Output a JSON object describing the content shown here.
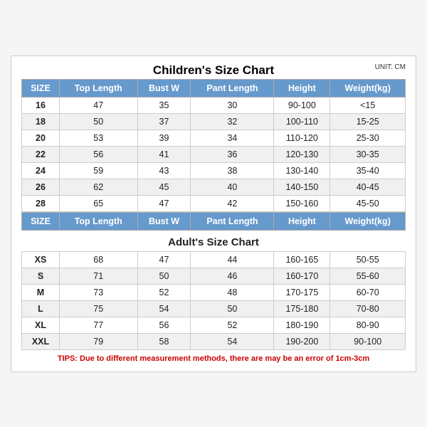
{
  "mainTitle": "Children's Size Chart",
  "unitLabel": "UNIT: CM",
  "children": {
    "headers": [
      "SIZE",
      "Top Length",
      "Bust W",
      "Pant Length",
      "Height",
      "Weight(kg)"
    ],
    "rows": [
      [
        "16",
        "47",
        "35",
        "30",
        "90-100",
        "<15"
      ],
      [
        "18",
        "50",
        "37",
        "32",
        "100-110",
        "15-25"
      ],
      [
        "20",
        "53",
        "39",
        "34",
        "110-120",
        "25-30"
      ],
      [
        "22",
        "56",
        "41",
        "36",
        "120-130",
        "30-35"
      ],
      [
        "24",
        "59",
        "43",
        "38",
        "130-140",
        "35-40"
      ],
      [
        "26",
        "62",
        "45",
        "40",
        "140-150",
        "40-45"
      ],
      [
        "28",
        "65",
        "47",
        "42",
        "150-160",
        "45-50"
      ]
    ]
  },
  "adultsTitle": "Adult's Size Chart",
  "adults": {
    "headers": [
      "SIZE",
      "Top Length",
      "Bust W",
      "Pant Length",
      "Height",
      "Weight(kg)"
    ],
    "rows": [
      [
        "XS",
        "68",
        "47",
        "44",
        "160-165",
        "50-55"
      ],
      [
        "S",
        "71",
        "50",
        "46",
        "160-170",
        "55-60"
      ],
      [
        "M",
        "73",
        "52",
        "48",
        "170-175",
        "60-70"
      ],
      [
        "L",
        "75",
        "54",
        "50",
        "175-180",
        "70-80"
      ],
      [
        "XL",
        "77",
        "56",
        "52",
        "180-190",
        "80-90"
      ],
      [
        "XXL",
        "79",
        "58",
        "54",
        "190-200",
        "90-100"
      ]
    ]
  },
  "tips": "TIPS: Due to different measurement methods, there are may be an error of 1cm-3cm"
}
